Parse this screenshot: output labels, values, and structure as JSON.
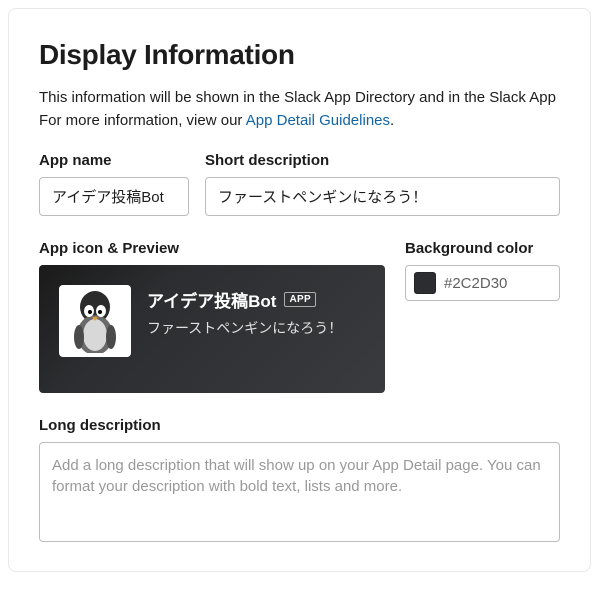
{
  "heading": "Display Information",
  "intro_line1": "This information will be shown in the Slack App Directory and in the Slack App",
  "intro_line2_prefix": "For more information, view our ",
  "intro_link": "App Detail Guidelines",
  "intro_line2_suffix": ".",
  "form": {
    "app_name": {
      "label": "App name",
      "value": "アイデア投稿Bot"
    },
    "short_desc": {
      "label": "Short description",
      "value": "ファーストペンギンになろう！"
    },
    "preview": {
      "label": "App icon & Preview",
      "title": "アイデア投稿Bot",
      "badge": "APP",
      "desc": "ファーストペンギンになろう！"
    },
    "bg_color": {
      "label": "Background color",
      "value": "#2C2D30"
    },
    "long_desc": {
      "label": "Long description",
      "placeholder": "Add a long description that will show up on your App Detail page. You can format your description with bold text, lists and more.",
      "value": ""
    }
  }
}
